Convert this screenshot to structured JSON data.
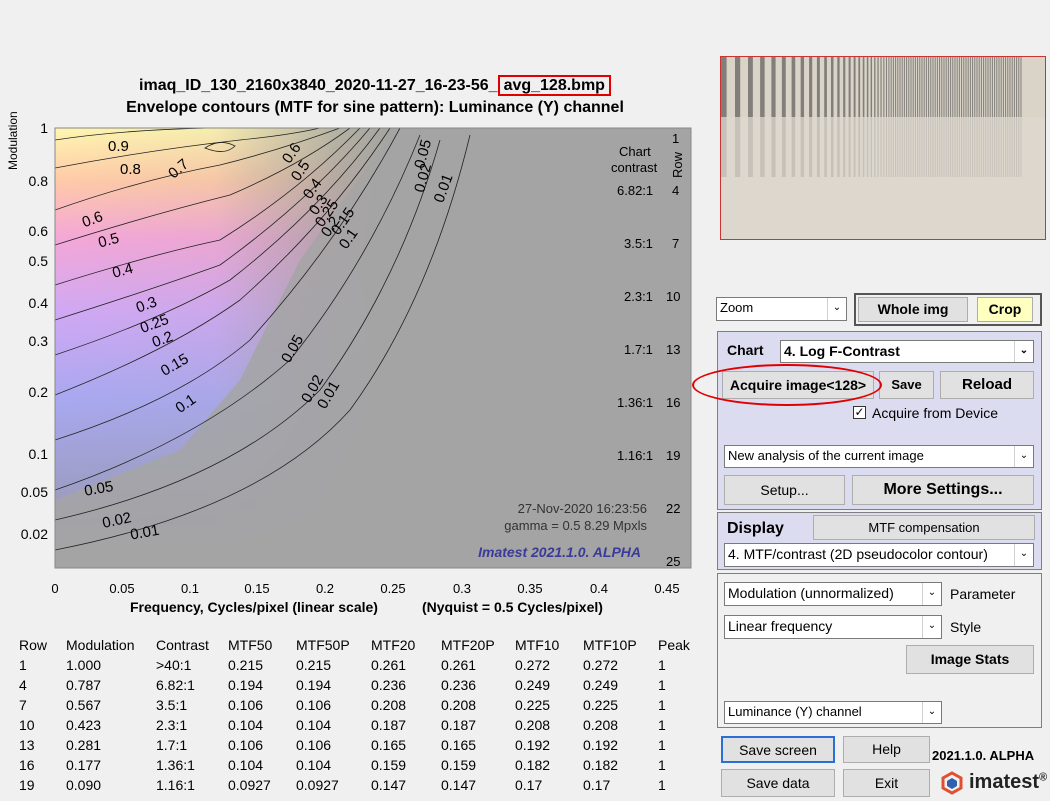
{
  "plot": {
    "title_file_prefix": "imaq_ID_130_2160x3840_2020-11-27_16-23-56_",
    "title_file_highlight": "avg_128.bmp",
    "subtitle": "Envelope contours (MTF for sine pattern):  Luminance (Y) channel",
    "ylabel": "Modulation",
    "xlabel": "Frequency, Cycles/pixel (linear scale)",
    "xlabel_note": "(Nyquist = 0.5 Cycles/pixel)",
    "y_ticks": [
      "1",
      "0.8",
      "0.6",
      "0.5",
      "0.4",
      "0.3",
      "0.2",
      "0.1",
      "0.05",
      "0.02"
    ],
    "x_ticks": [
      "0",
      "0.05",
      "0.1",
      "0.15",
      "0.2",
      "0.25",
      "0.3",
      "0.35",
      "0.4",
      "0.45"
    ],
    "chart_contrast_label": "Chart contrast",
    "row_label": "Row",
    "chart_contrast_values": [
      "6.82:1",
      "3.5:1",
      "2.3:1",
      "1.7:1",
      "1.36:1",
      "1.16:1"
    ],
    "row_ticks": [
      "1",
      "4",
      "7",
      "10",
      "13",
      "16",
      "19",
      "22",
      "25"
    ],
    "contour_labels": [
      "0.9",
      "0.8",
      "0.7",
      "0.6",
      "0.5",
      "0.4",
      "0.3",
      "0.25",
      "0.2",
      "0.15",
      "0.1",
      "0.05",
      "0.02",
      "0.01",
      "0.6",
      "0.5",
      "0.4",
      "0.3",
      "0.25",
      "0.2",
      "0.15",
      "0.1",
      "0.05",
      "0.02",
      "0.01",
      "0.05",
      "0.02",
      "0.01"
    ],
    "timestamp": "27-Nov-2020 16:23:56",
    "gamma_info": "gamma = 0.5   8.29 Mpxls",
    "watermark": "Imatest 2021.1.0. ALPHA"
  },
  "table": {
    "headers": [
      "Row",
      "Modulation",
      "Contrast",
      "MTF50",
      "MTF50P",
      "MTF20",
      "MTF20P",
      "MTF10",
      "MTF10P",
      "Peak"
    ],
    "rows": [
      [
        "1",
        "1.000",
        ">40:1",
        "0.215",
        "0.215",
        "0.261",
        "0.261",
        "0.272",
        "0.272",
        "1"
      ],
      [
        "4",
        "0.787",
        "6.82:1",
        "0.194",
        "0.194",
        "0.236",
        "0.236",
        "0.249",
        "0.249",
        "1"
      ],
      [
        "7",
        "0.567",
        "3.5:1",
        "0.106",
        "0.106",
        "0.208",
        "0.208",
        "0.225",
        "0.225",
        "1"
      ],
      [
        "10",
        "0.423",
        "2.3:1",
        "0.104",
        "0.104",
        "0.187",
        "0.187",
        "0.208",
        "0.208",
        "1"
      ],
      [
        "13",
        "0.281",
        "1.7:1",
        "0.106",
        "0.106",
        "0.165",
        "0.165",
        "0.192",
        "0.192",
        "1"
      ],
      [
        "16",
        "0.177",
        "1.36:1",
        "0.104",
        "0.104",
        "0.159",
        "0.159",
        "0.182",
        "0.182",
        "1"
      ],
      [
        "19",
        "0.090",
        "1.16:1",
        "0.0927",
        "0.0927",
        "0.147",
        "0.147",
        "0.17",
        "0.17",
        "1"
      ]
    ]
  },
  "controls": {
    "zoom_select": "Zoom",
    "whole_img": "Whole img",
    "crop": "Crop",
    "chart_label": "Chart",
    "chart_select": "4. Log F-Contrast",
    "acquire_button": "Acquire image<128>",
    "save_button": "Save",
    "reload_button": "Reload",
    "acquire_from_device": "Acquire from Device",
    "acquire_checked": true,
    "analysis_select": "New analysis of the current image",
    "setup_button": "Setup...",
    "more_settings_button": "More Settings...",
    "display_label": "Display",
    "mtf_compensation_button": "MTF compensation",
    "display_select": "4. MTF/contrast (2D pseudocolor contour)",
    "parameter_select": "Modulation (unnormalized)",
    "parameter_label": "Parameter",
    "style_select": "Linear frequency",
    "style_label": "Style",
    "image_stats_button": "Image Stats",
    "channel_select": "Luminance (Y) channel",
    "save_screen_button": "Save screen",
    "help_button": "Help",
    "version": "2021.1.0. ALPHA",
    "save_data_button": "Save data",
    "exit_button": "Exit",
    "brand": "imatest",
    "brand_mark": "®"
  },
  "colors": {
    "highlight_red": "#e00000",
    "crop_yellow": "#ffffc0",
    "panel_blue": "#dcdcf0",
    "watermark_blue": "#3a3a9a"
  }
}
